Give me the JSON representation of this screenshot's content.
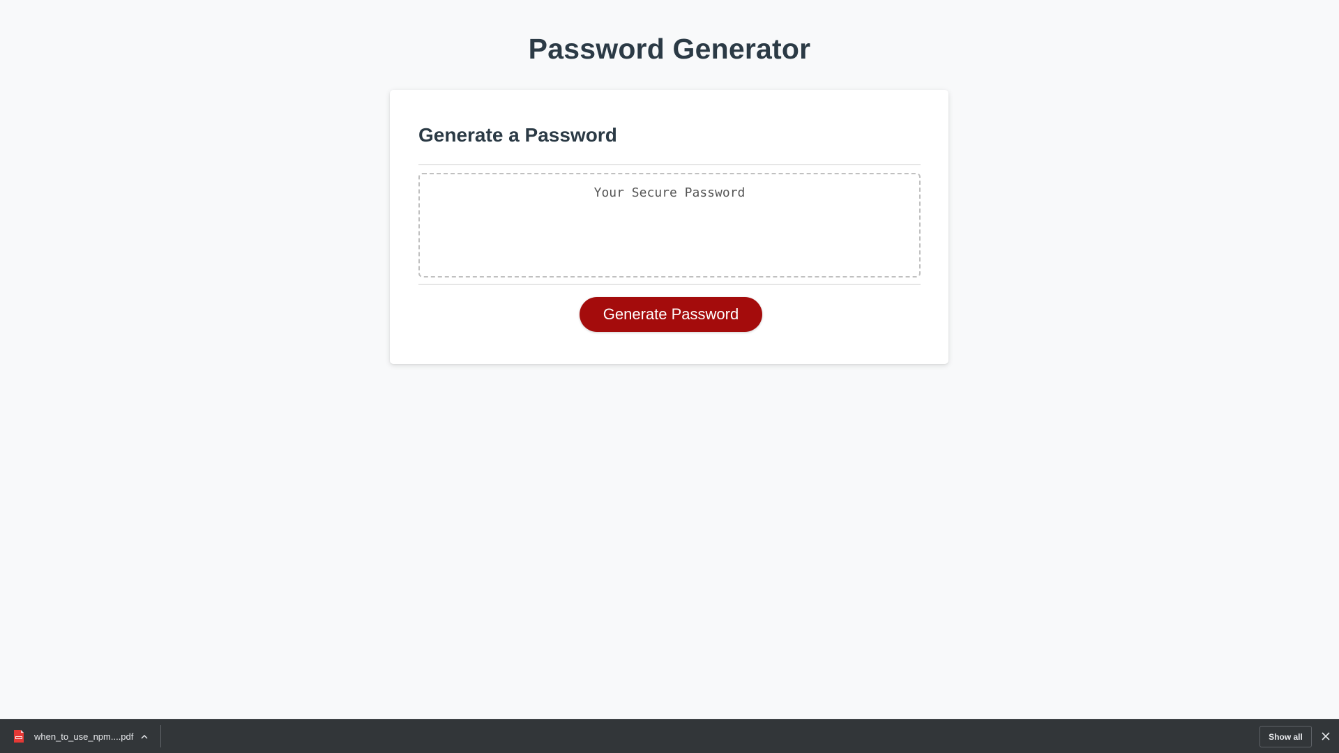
{
  "page": {
    "title": "Password Generator"
  },
  "card": {
    "title": "Generate a Password",
    "password_placeholder": "Your Secure Password",
    "password_value": "",
    "generate_label": "Generate Password"
  },
  "download_bar": {
    "item": {
      "filename": "when_to_use_npm....pdf",
      "file_icon": "pdf-icon"
    },
    "show_all_label": "Show all",
    "close_icon": "close-icon"
  },
  "colors": {
    "background": "#f8f9fa",
    "text": "#2b3a45",
    "button": "#a40c0c",
    "download_bar": "#323639"
  }
}
